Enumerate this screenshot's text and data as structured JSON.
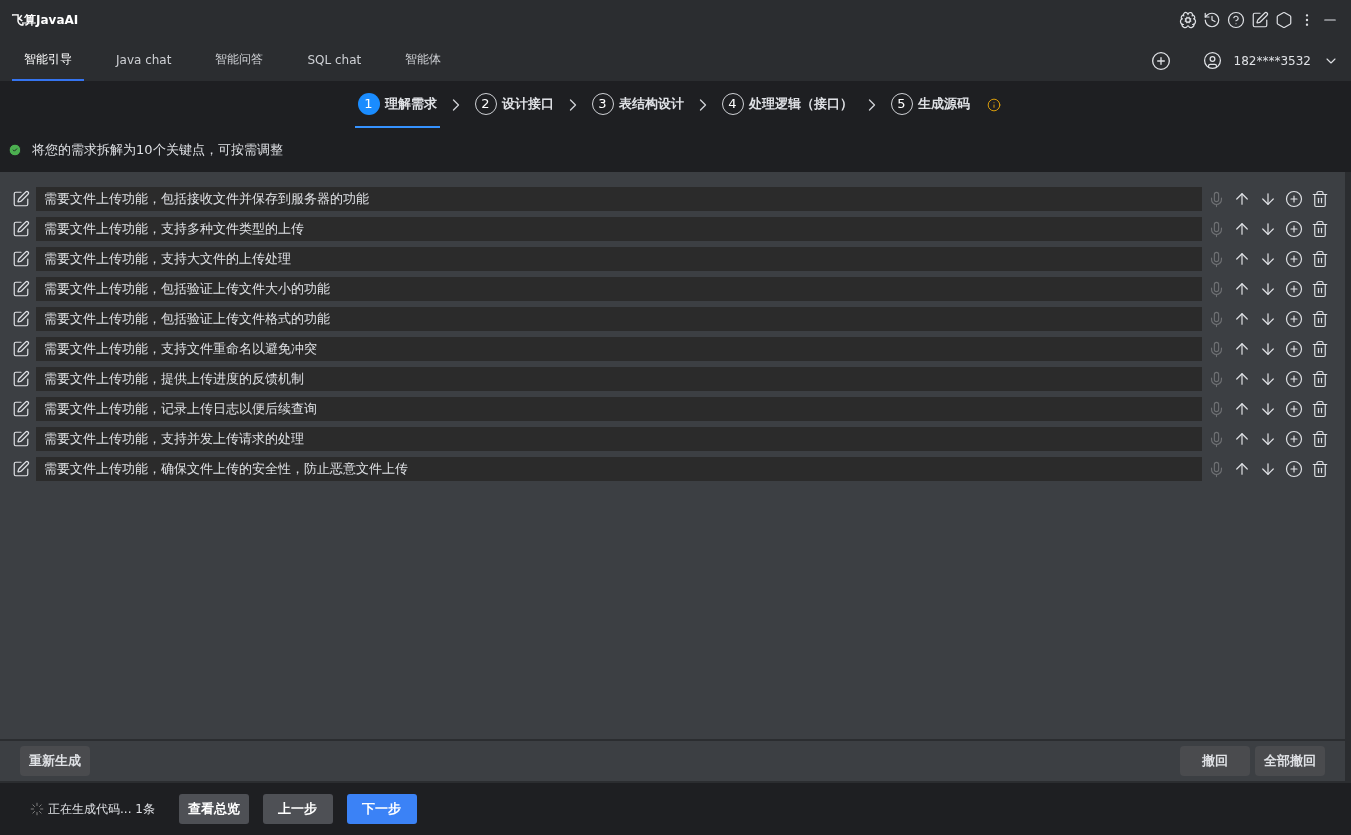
{
  "window": {
    "title": "飞算JavaAI"
  },
  "tabs": [
    {
      "label": "智能引导",
      "selected": true
    },
    {
      "label": "Java chat",
      "selected": false
    },
    {
      "label": "智能问答",
      "selected": false
    },
    {
      "label": "SQL chat",
      "selected": false
    },
    {
      "label": "智能体",
      "selected": false
    }
  ],
  "account": {
    "user": "182****3532"
  },
  "steps": [
    {
      "number": "1",
      "label": "理解需求",
      "selected": true
    },
    {
      "number": "2",
      "label": "设计接口",
      "selected": false
    },
    {
      "number": "3",
      "label": "表结构设计",
      "selected": false
    },
    {
      "number": "4",
      "label": "处理逻辑（接口）",
      "selected": false
    },
    {
      "number": "5",
      "label": "生成源码",
      "selected": false
    }
  ],
  "status_message": "将您的需求拆解为10个关键点，可按需调整",
  "requirements": [
    {
      "text": "需要文件上传功能，包括接收文件并保存到服务器的功能"
    },
    {
      "text": "需要文件上传功能，支持多种文件类型的上传"
    },
    {
      "text": "需要文件上传功能，支持大文件的上传处理"
    },
    {
      "text": "需要文件上传功能，包括验证上传文件大小的功能"
    },
    {
      "text": "需要文件上传功能，包括验证上传文件格式的功能"
    },
    {
      "text": "需要文件上传功能，支持文件重命名以避免冲突"
    },
    {
      "text": "需要文件上传功能，提供上传进度的反馈机制"
    },
    {
      "text": "需要文件上传功能，记录上传日志以便后续查询"
    },
    {
      "text": "需要文件上传功能，支持并发上传请求的处理"
    },
    {
      "text": "需要文件上传功能，确保文件上传的安全性，防止恶意文件上传"
    }
  ],
  "panel_actions": {
    "left": [
      "重新生成"
    ],
    "right": [
      "撤回",
      "全部撤回"
    ]
  },
  "footer": {
    "progress": "正在生成代码... 1条",
    "buttons": [
      {
        "label": "查看总览",
        "kind": "secondary"
      },
      {
        "label": "上一步",
        "kind": "secondary"
      },
      {
        "label": "下一步",
        "kind": "primary"
      }
    ]
  }
}
